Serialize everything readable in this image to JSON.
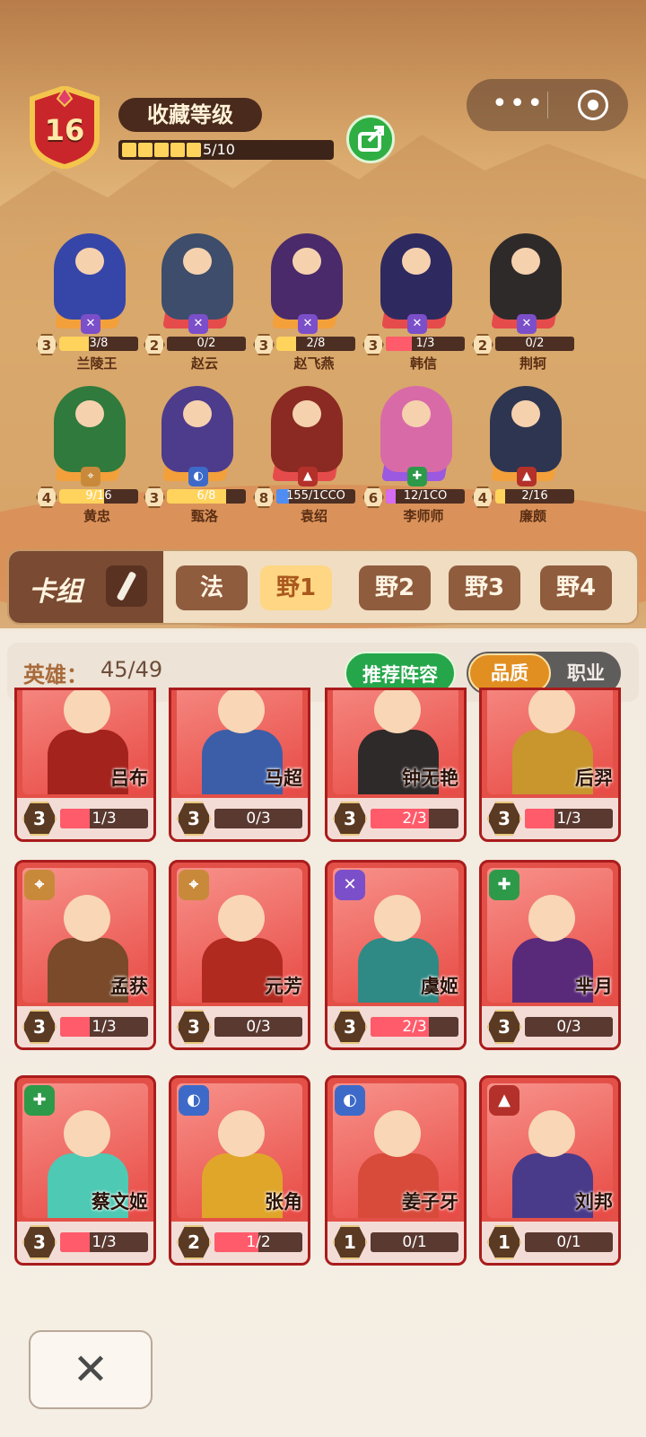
{
  "header": {
    "level": "16",
    "title": "收藏等级",
    "progress_text": "5/10",
    "progress_value": 0.5
  },
  "team": [
    {
      "name": "兰陵王",
      "star": "3",
      "progress": "3/8",
      "value": 0.375,
      "class_icon": "mage-icon",
      "class_color": "#7b4fc9",
      "plat_color": "#f3a03b",
      "skin": "#3646a8",
      "bar_color": "#ffd35c"
    },
    {
      "name": "赵云",
      "star": "2",
      "progress": "0/2",
      "value": 0,
      "class_icon": "mage-icon",
      "class_color": "#7b4fc9",
      "plat_color": "#e64b4b",
      "skin": "#3d4d6b",
      "bar_color": "#ff5b6b"
    },
    {
      "name": "赵飞燕",
      "star": "3",
      "progress": "2/8",
      "value": 0.25,
      "class_icon": "mage-icon",
      "class_color": "#7b4fc9",
      "plat_color": "#f3a03b",
      "skin": "#4a2a6a",
      "bar_color": "#ffd35c"
    },
    {
      "name": "韩信",
      "star": "3",
      "progress": "1/3",
      "value": 0.333,
      "class_icon": "mage-icon",
      "class_color": "#7b4fc9",
      "plat_color": "#e64b4b",
      "skin": "#2e2a60",
      "bar_color": "#ff5b6b"
    },
    {
      "name": "荆轲",
      "star": "2",
      "progress": "0/2",
      "value": 0,
      "class_icon": "mage-icon",
      "class_color": "#7b4fc9",
      "plat_color": "#e64b4b",
      "skin": "#2f2a2a",
      "bar_color": "#ff5b6b"
    },
    {
      "name": "黄忠",
      "star": "4",
      "progress": "9/16",
      "value": 0.5625,
      "class_icon": "bow-icon",
      "class_color": "#c88a3a",
      "plat_color": "#f3a03b",
      "skin": "#2f7a3c",
      "bar_color": "#ffd35c"
    },
    {
      "name": "甄洛",
      "star": "3",
      "progress": "6/8",
      "value": 0.75,
      "class_icon": "helmet-icon",
      "class_color": "#3d6ac9",
      "plat_color": "#f3a03b",
      "skin": "#4d3b8c",
      "bar_color": "#ffd35c"
    },
    {
      "name": "袁绍",
      "star": "8",
      "progress": "155/1CCO",
      "value": 0.155,
      "class_icon": "shield-icon",
      "class_color": "#b3312a",
      "plat_color": "#e64b4b",
      "skin": "#8a2a22",
      "bar_color": "#4f8df2"
    },
    {
      "name": "李师师",
      "star": "6",
      "progress": "12/1CO",
      "value": 0.12,
      "class_icon": "heal-icon",
      "class_color": "#2d9a4a",
      "plat_color": "#9b58e0",
      "skin": "#d96aa8",
      "bar_color": "#d66cf0"
    },
    {
      "name": "廉颇",
      "star": "4",
      "progress": "2/16",
      "value": 0.125,
      "class_icon": "shield-icon",
      "class_color": "#b3312a",
      "plat_color": "#f3a03b",
      "skin": "#2d3550",
      "bar_color": "#ffd35c"
    }
  ],
  "deck": {
    "label": "卡组",
    "tabs": [
      "法",
      "野1",
      "野2",
      "野3",
      "野4"
    ],
    "active_tab": "野1"
  },
  "summary": {
    "label": "英雄：",
    "count": "45/49",
    "recommend_label": "推荐阵容",
    "toggle_on": "品质",
    "toggle_off": "职业"
  },
  "cards": [
    {
      "name": "吕布",
      "star": "3",
      "progress": "1/3",
      "value": 0.333,
      "class_icon": "",
      "class_color": "",
      "body": "#a4231d"
    },
    {
      "name": "马超",
      "star": "3",
      "progress": "0/3",
      "value": 0,
      "class_icon": "",
      "class_color": "",
      "body": "#3c5ea8"
    },
    {
      "name": "钟无艳",
      "star": "3",
      "progress": "2/3",
      "value": 0.667,
      "class_icon": "",
      "class_color": "",
      "body": "#2e2a2a"
    },
    {
      "name": "后羿",
      "star": "3",
      "progress": "1/3",
      "value": 0.333,
      "class_icon": "",
      "class_color": "",
      "body": "#c8962c"
    },
    {
      "name": "孟获",
      "star": "3",
      "progress": "1/3",
      "value": 0.333,
      "class_icon": "bow-icon",
      "class_color": "#c88a3a",
      "body": "#7a4a2a"
    },
    {
      "name": "元芳",
      "star": "3",
      "progress": "0/3",
      "value": 0,
      "class_icon": "bow-icon",
      "class_color": "#c88a3a",
      "body": "#b02a20"
    },
    {
      "name": "虞姬",
      "star": "3",
      "progress": "2/3",
      "value": 0.667,
      "class_icon": "mage-icon",
      "class_color": "#7b4fc9",
      "body": "#2f8a86"
    },
    {
      "name": "芈月",
      "star": "3",
      "progress": "0/3",
      "value": 0,
      "class_icon": "heal-icon",
      "class_color": "#2d9a4a",
      "body": "#5a2a7a"
    },
    {
      "name": "蔡文姬",
      "star": "3",
      "progress": "1/3",
      "value": 0.333,
      "class_icon": "heal-icon",
      "class_color": "#2d9a4a",
      "body": "#4ec9b4"
    },
    {
      "name": "张角",
      "star": "2",
      "progress": "1/2",
      "value": 0.5,
      "class_icon": "helmet-icon",
      "class_color": "#3d6ac9",
      "body": "#e0a62a"
    },
    {
      "name": "姜子牙",
      "star": "1",
      "progress": "0/1",
      "value": 0,
      "class_icon": "helmet-icon",
      "class_color": "#3d6ac9",
      "body": "#d84a3a"
    },
    {
      "name": "刘邦",
      "star": "1",
      "progress": "0/1",
      "value": 0,
      "class_icon": "shield-icon",
      "class_color": "#b3312a",
      "body": "#4a3a8a"
    }
  ],
  "close_label": "✕"
}
